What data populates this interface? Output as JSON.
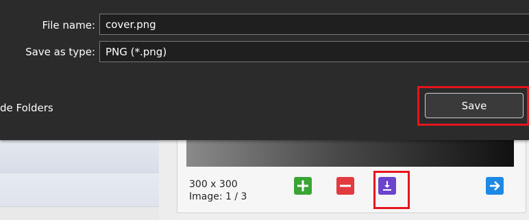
{
  "dialog": {
    "file_name_label": "File name:",
    "file_name_value": "cover.png",
    "save_type_label": "Save as type:",
    "save_type_value": "PNG (*.png)",
    "folders_text": "de Folders",
    "save_button_label": "Save"
  },
  "panel": {
    "dimensions": "300 x 300",
    "image_index": "Image: 1 / 3"
  },
  "icons": [
    "plus-icon",
    "minus-icon",
    "download-icon",
    "arrow-right-icon"
  ],
  "colors": {
    "dialog_bg": "#2b2b2b",
    "highlight": "#e8141b",
    "add": "#3aa535",
    "remove": "#e23a3f",
    "download": "#6b44cc",
    "next": "#1e88e5"
  }
}
